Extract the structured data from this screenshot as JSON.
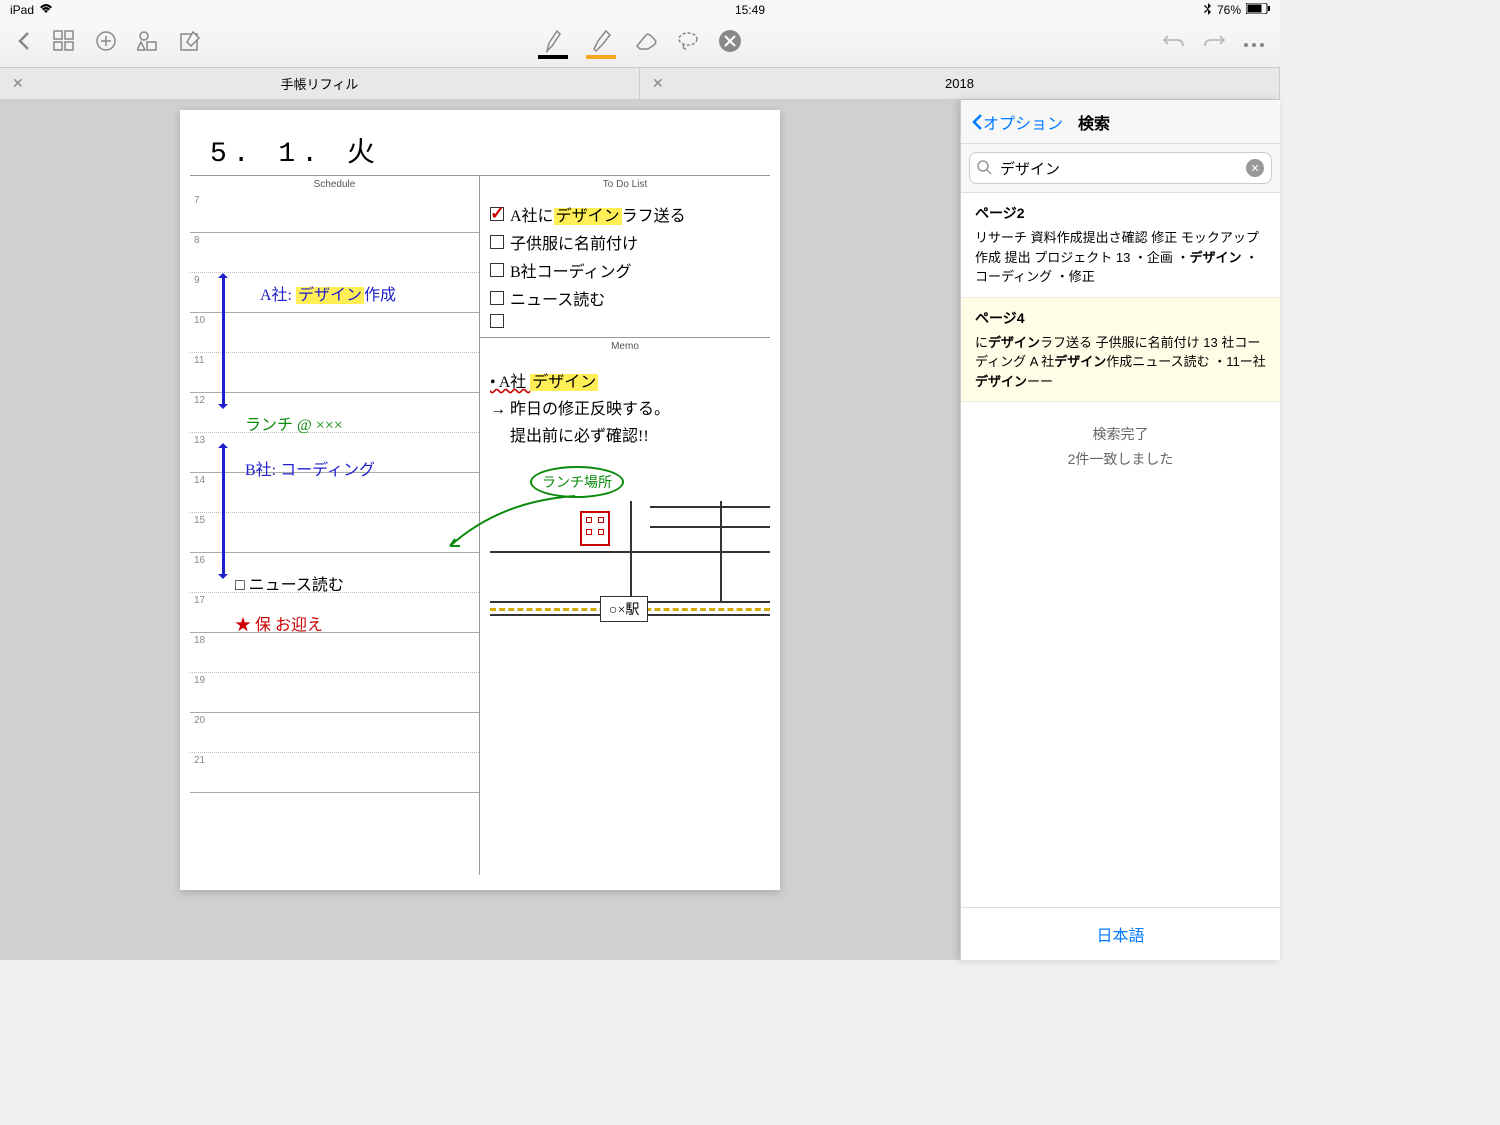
{
  "status": {
    "device": "iPad",
    "time": "15:49",
    "battery": "76%"
  },
  "tabs": [
    {
      "title": "手帳リフィル"
    },
    {
      "title": "2018"
    }
  ],
  "page": {
    "date": "5. 1. 火",
    "headers": {
      "schedule": "Schedule",
      "todo": "To Do List",
      "memo": "Memo"
    },
    "hours": [
      "7",
      "8",
      "9",
      "10",
      "11",
      "12",
      "13",
      "14",
      "15",
      "16",
      "17",
      "18",
      "19",
      "20",
      "21"
    ],
    "schedule": {
      "item1_prefix": "A社: ",
      "item1_hl": "デザイン",
      "item1_suffix": "作成",
      "lunch": "ランチ @ ×××",
      "item2": "B社: コーディング",
      "news": "□ ニュース読む",
      "pickup": "★ 保 お迎え"
    },
    "todo": [
      {
        "checked": true,
        "prefix": "A社に",
        "hl": "デザイン",
        "suffix": "ラフ送る"
      },
      {
        "checked": false,
        "text": "子供服に名前付け"
      },
      {
        "checked": false,
        "text": "B社コーディング"
      },
      {
        "checked": false,
        "text": "ニュース読む"
      },
      {
        "checked": false,
        "text": ""
      }
    ],
    "memo": {
      "bullet_prefix": "• A社 ",
      "bullet_hl": "デザイン",
      "line2": "→ 昨日の修正反映する。",
      "line3": "　 提出前に必ず確認!!",
      "lunch_place": "ランチ場所",
      "station": "○×駅"
    }
  },
  "search": {
    "back": "オプション",
    "title": "検索",
    "query": "デザイン",
    "results": [
      {
        "page": "ページ2",
        "snippet_html": "リサーチ 資料作成提出さ確認 修正 モックアップ作成 提出 プロジェクト 13 ・企画 ・<b>デザイン</b> ・コーディング ・修正",
        "active": false
      },
      {
        "page": "ページ4",
        "snippet_html": "に<b>デザイン</b>ラフ送る 子供服に名前付け 13 社コーディング A 社<b>デザイン</b>作成ニュース読む ・11ー社<b>デザイン</b>ーー",
        "active": true
      }
    ],
    "status1": "検索完了",
    "status2": "2件一致しました",
    "footer": "日本語"
  }
}
